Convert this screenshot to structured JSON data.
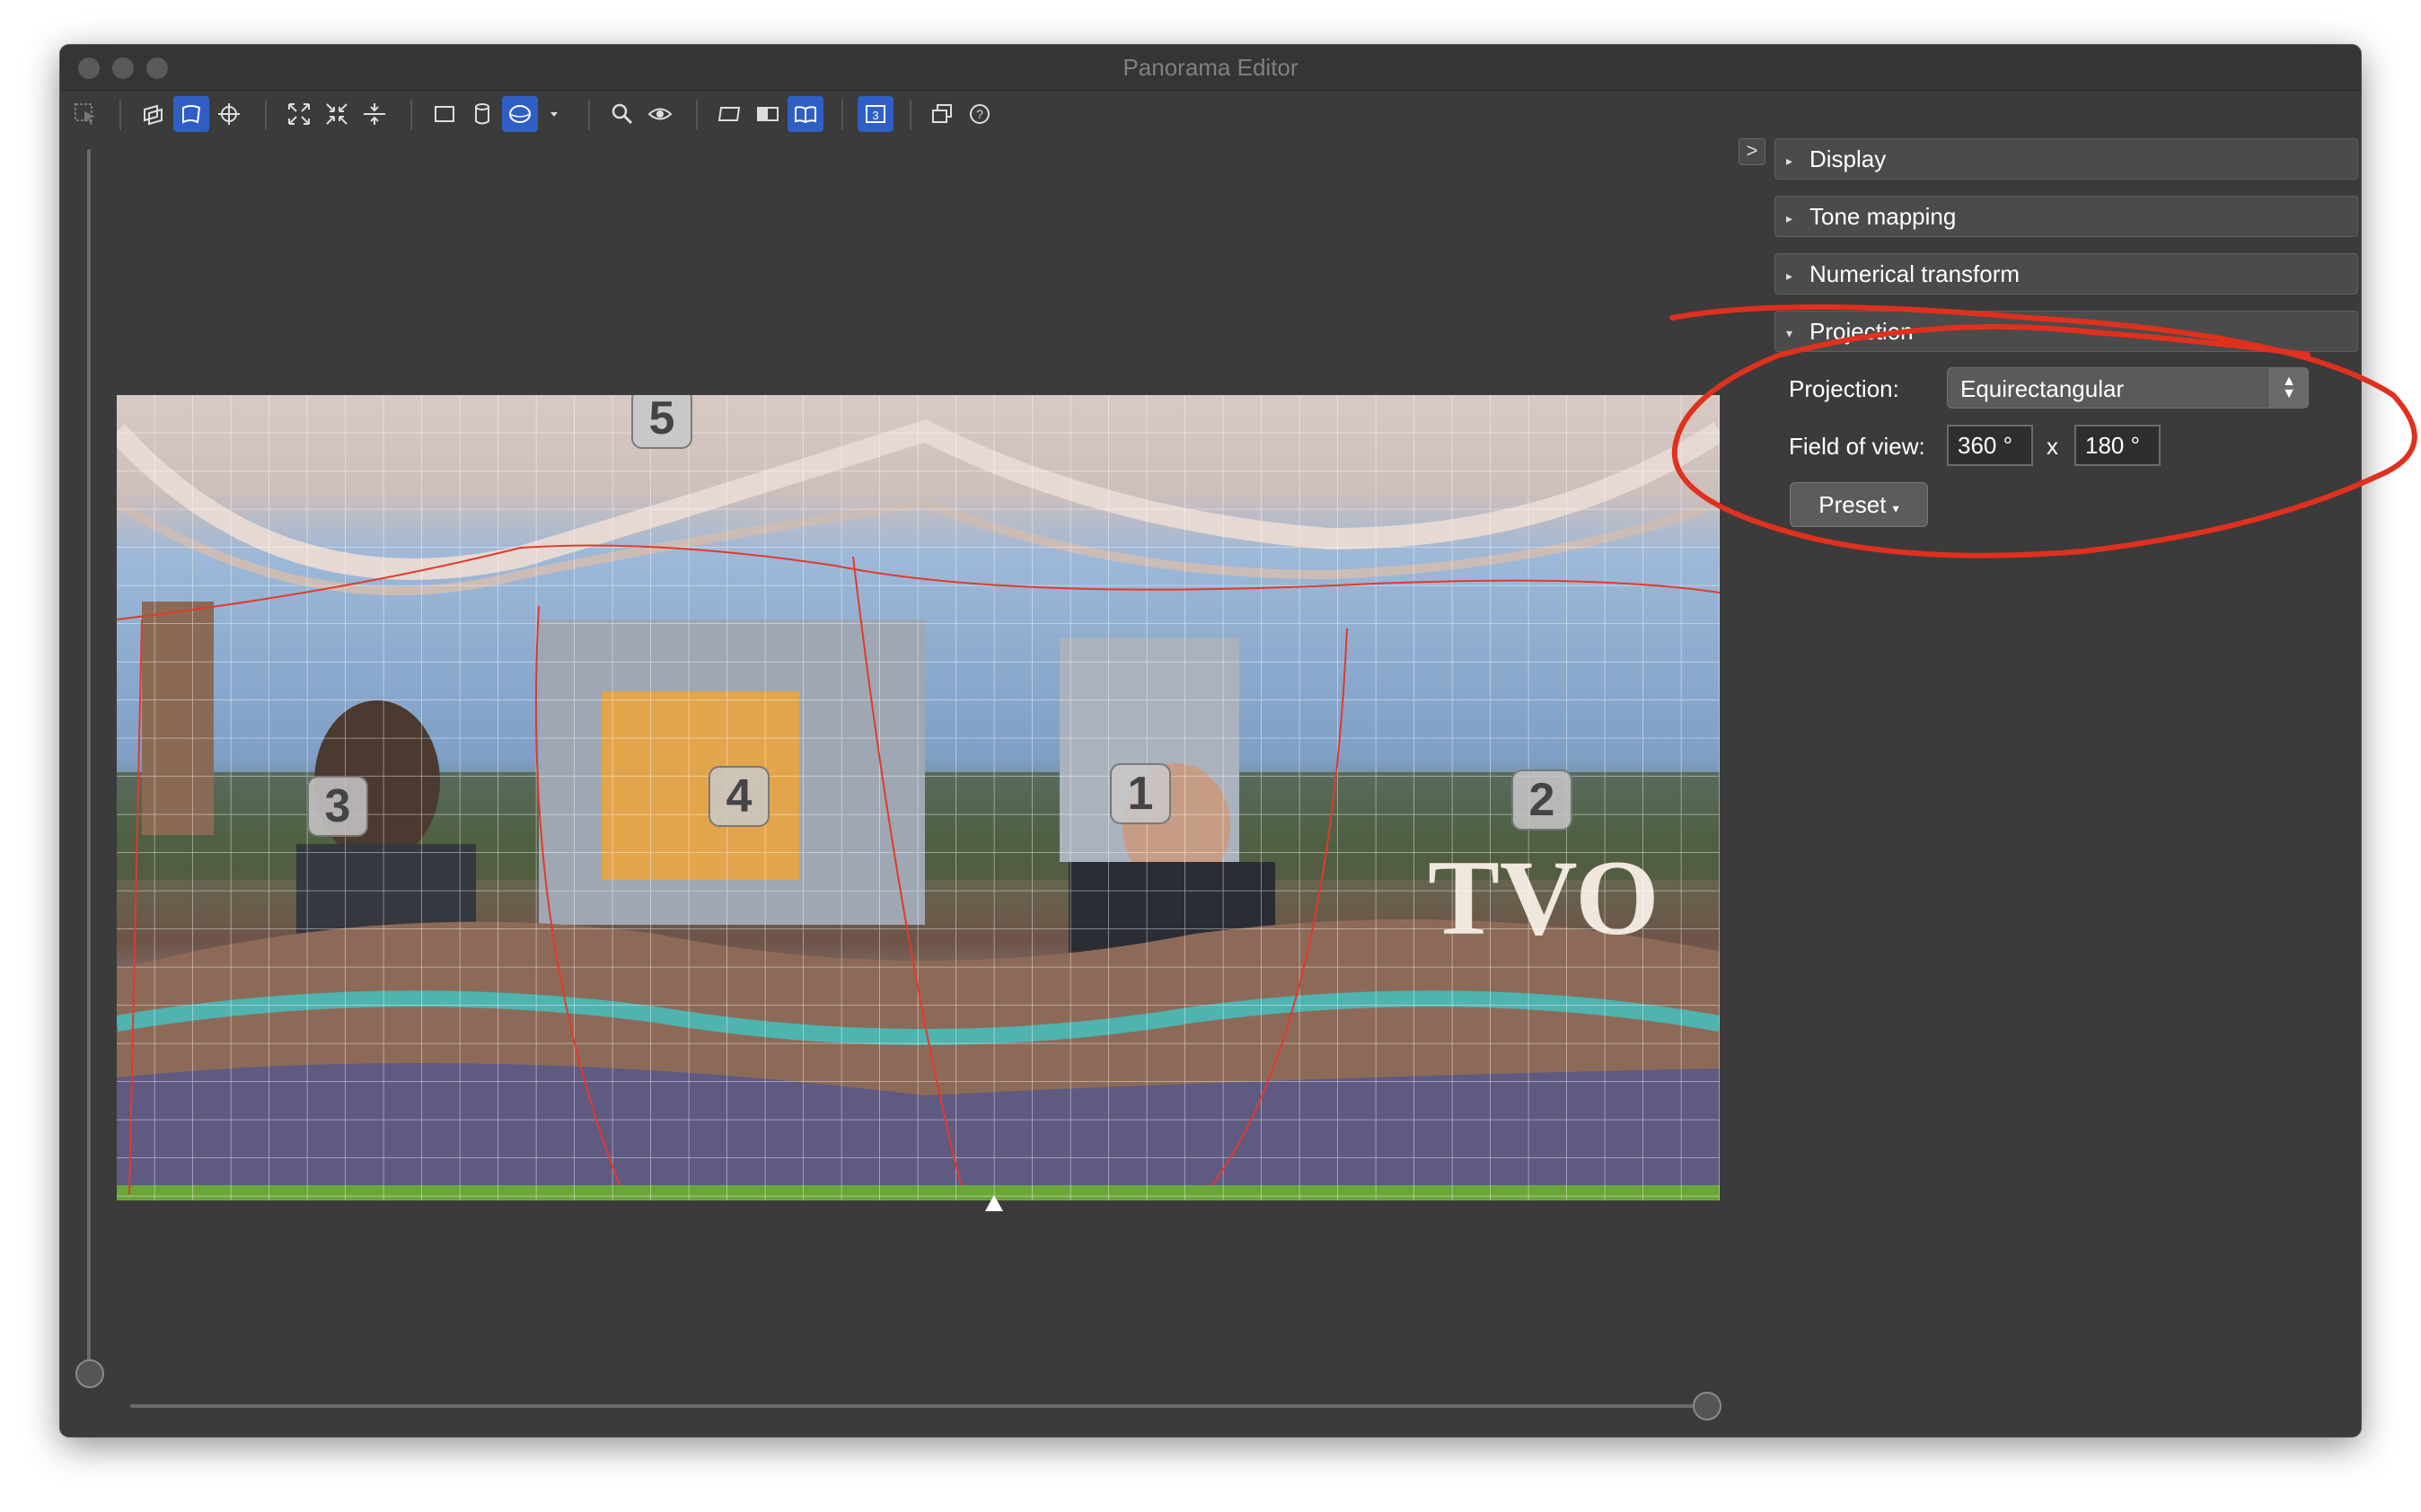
{
  "window": {
    "title": "Panorama Editor"
  },
  "toolbar": {
    "tools": [
      {
        "icon": "select-arrow-icon",
        "active": false
      },
      {
        "icon": "layers-move-icon",
        "active": false
      },
      {
        "icon": "drag-image-icon",
        "active": true
      },
      {
        "icon": "crosshair-icon",
        "active": false
      },
      {
        "icon": "fit-expand-icon",
        "active": false
      },
      {
        "icon": "fit-shrink-icon",
        "active": false
      },
      {
        "icon": "straighten-icon",
        "active": false
      },
      {
        "icon": "rectilinear-icon",
        "active": false
      },
      {
        "icon": "cylindrical-icon",
        "active": false
      },
      {
        "icon": "spherical-icon",
        "active": true
      },
      {
        "icon": "dropdown-arrow-icon",
        "active": false
      },
      {
        "icon": "zoom-icon",
        "active": false
      },
      {
        "icon": "preview-eye-icon",
        "active": false
      },
      {
        "icon": "layout-left-icon",
        "active": false
      },
      {
        "icon": "layout-split-icon",
        "active": false
      },
      {
        "icon": "layout-book-icon",
        "active": true
      },
      {
        "icon": "numbered-view-icon",
        "active": true
      },
      {
        "icon": "stack-windows-icon",
        "active": false
      },
      {
        "icon": "help-icon",
        "active": false
      }
    ]
  },
  "panel": {
    "toggle_label": ">",
    "sections": {
      "display": "Display",
      "tone_mapping": "Tone mapping",
      "numerical_transform": "Numerical transform",
      "projection": "Projection"
    },
    "projection": {
      "label": "Projection:",
      "selected": "Equirectangular",
      "fov_label": "Field of view:",
      "fov_h": "360 °",
      "fov_separator": "x",
      "fov_v": "180 °",
      "preset_label": "Preset",
      "preset_arrow": "▾"
    }
  },
  "canvas": {
    "markers": [
      "5",
      "3",
      "4",
      "1",
      "2"
    ]
  },
  "colors": {
    "annotation": "#e0301e",
    "accent": "#2f5fc4"
  }
}
